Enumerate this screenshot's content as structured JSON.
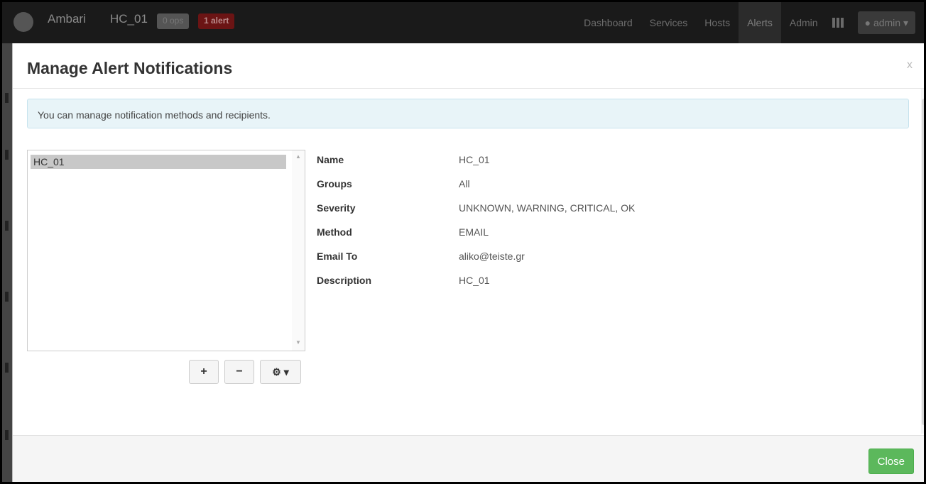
{
  "navbar": {
    "brand": "Ambari",
    "cluster": "HC_01",
    "ops_badge": "0 ops",
    "alert_badge": "1 alert",
    "items": [
      "Dashboard",
      "Services",
      "Hosts",
      "Alerts",
      "Admin"
    ],
    "active_item": "Alerts",
    "user_label": "admin"
  },
  "modal": {
    "title": "Manage Alert Notifications",
    "close_x": "x",
    "info": "You can manage notification methods and recipients.",
    "list": {
      "items": [
        "HC_01"
      ],
      "selected": "HC_01"
    },
    "details": {
      "name_label": "Name",
      "name_value": "HC_01",
      "groups_label": "Groups",
      "groups_value": "All",
      "severity_label": "Severity",
      "severity_value": "UNKNOWN, WARNING, CRITICAL, OK",
      "method_label": "Method",
      "method_value": "EMAIL",
      "email_label": "Email To",
      "email_value": "aliko@teiste.gr",
      "description_label": "Description",
      "description_value": "HC_01"
    },
    "buttons": {
      "add": "+",
      "remove": "−",
      "gear": "⚙ ▾"
    },
    "footer": {
      "close_label": "Close"
    }
  },
  "colors": {
    "close_button": "#5cb85c",
    "info_background": "#e8f4f8",
    "navbar": "#1a1a1a"
  }
}
